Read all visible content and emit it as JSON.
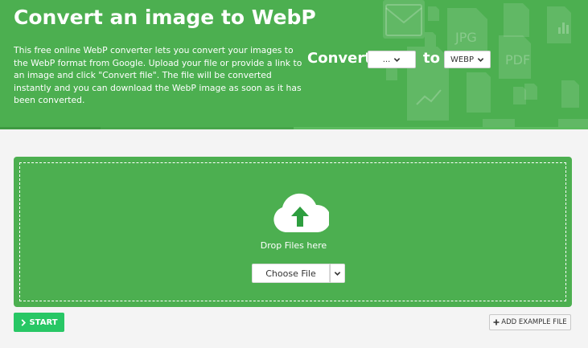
{
  "hero": {
    "title": "Convert an image to WebP",
    "description": "This free online WebP converter lets you convert your images to the WebP format from Google. Upload your file or provide a link to an image and click \"Convert file\". The file will be converted instantly and you can download the WebP image as soon as it has been converted.",
    "convert_label": "Convert",
    "to_label": "to",
    "from_select_value": "...",
    "to_select_value": "WEBP",
    "bg_icon_labels": {
      "jpg": "JPG",
      "pdf": "PDF"
    }
  },
  "dropzone": {
    "text": "Drop Files here",
    "choose_file_label": "Choose File"
  },
  "actions": {
    "start_label": "START",
    "add_example_label": "ADD EXAMPLE FILE"
  },
  "colors": {
    "brand_green": "#4caf50",
    "start_green": "#28c765",
    "upload_arrow": "#2e9e3f"
  }
}
